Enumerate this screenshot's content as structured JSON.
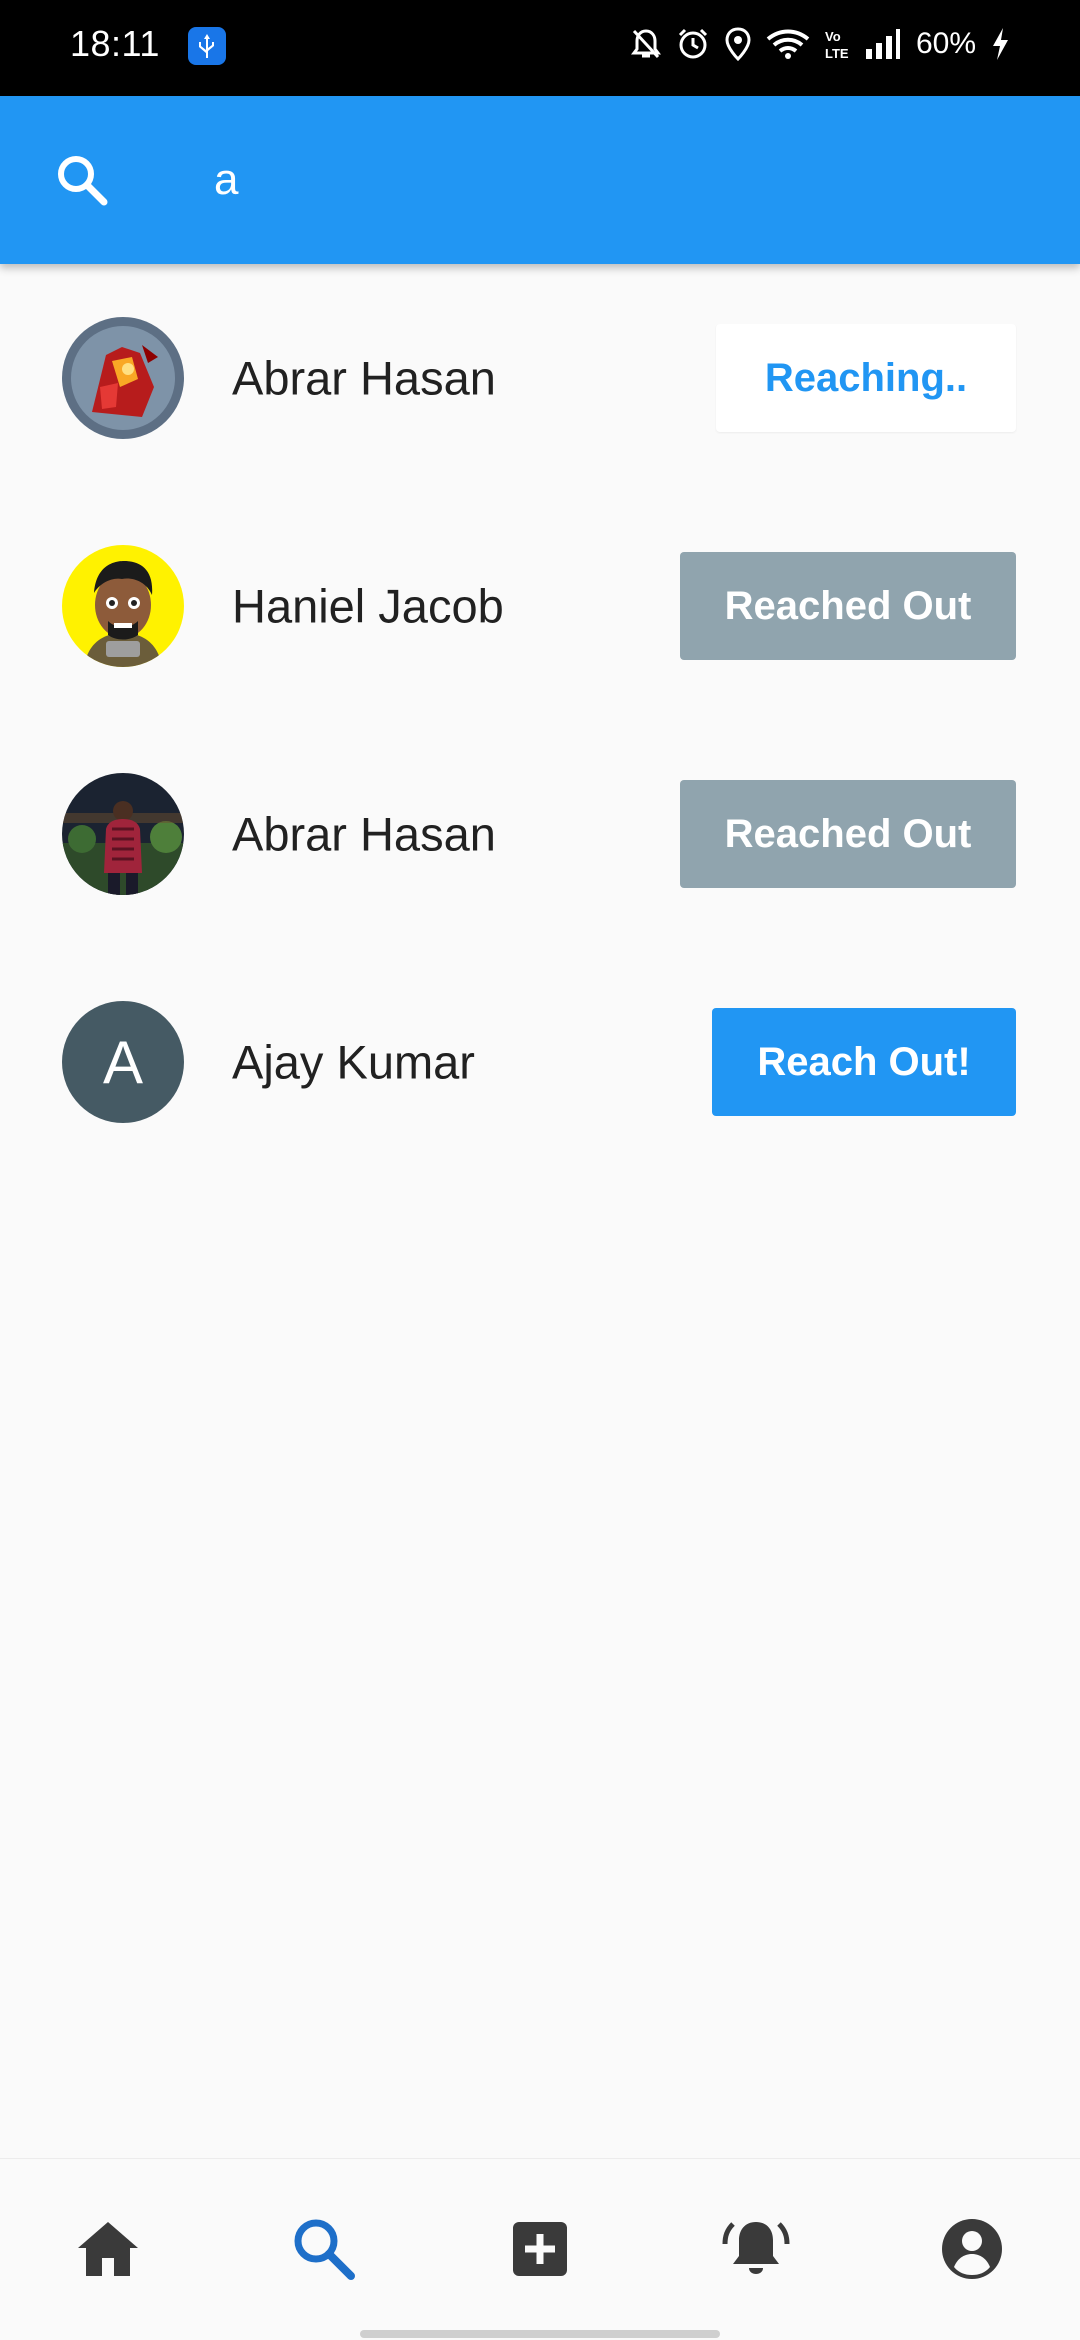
{
  "status_bar": {
    "time": "18:11",
    "battery": "60%",
    "icons": [
      "usb-icon",
      "mute-icon",
      "alarm-icon",
      "location-icon",
      "wifi-icon",
      "volte-icon",
      "signal-icon",
      "charging-icon"
    ]
  },
  "search": {
    "value": "a",
    "icon": "search-icon"
  },
  "results": [
    {
      "name": "Abrar Hasan",
      "button": "Reaching..",
      "state": "reaching",
      "avatar": "iron-man-avatar"
    },
    {
      "name": "Haniel Jacob",
      "button": "Reached Out",
      "state": "reached",
      "avatar": "bitmoji-avatar"
    },
    {
      "name": "Abrar Hasan",
      "button": "Reached Out",
      "state": "reached",
      "avatar": "photo-avatar"
    },
    {
      "name": "Ajay Kumar",
      "button": "Reach Out!",
      "state": "reach",
      "avatar_letter": "A"
    }
  ],
  "bottom_nav": {
    "items": [
      "home-icon",
      "search-icon",
      "add-box-icon",
      "notifications-icon",
      "account-icon"
    ],
    "active": "search-icon"
  },
  "colors": {
    "primary": "#2196f3",
    "reached": "#90a4ae",
    "avatar_letter_bg": "#455a64",
    "active_nav": "#1e6fc9",
    "inactive_nav": "#3a3a3a"
  }
}
